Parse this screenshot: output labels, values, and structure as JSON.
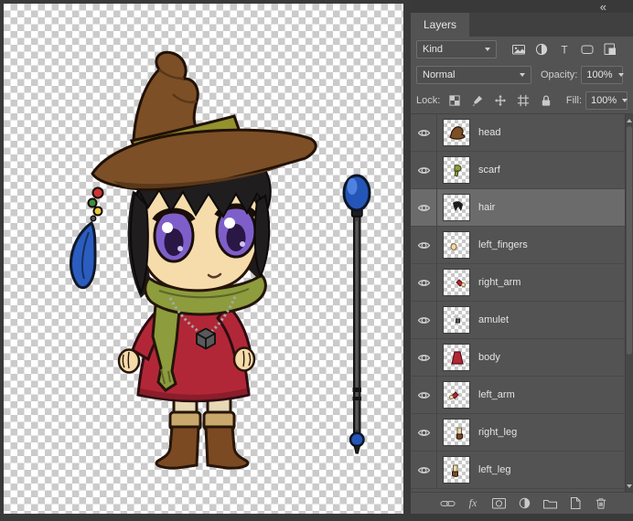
{
  "panel": {
    "collapse_glyph": "«",
    "tab_label": "Layers",
    "kind_label": "Kind",
    "blend_mode": "Normal",
    "opacity_label": "Opacity:",
    "opacity_value": "100%",
    "lock_label": "Lock:",
    "fill_label": "Fill:",
    "fill_value": "100%",
    "fx_label": "fx",
    "filter_icons": [
      "pixel-layers-filter-icon",
      "adjustment-layers-filter-icon",
      "type-layers-filter-icon",
      "shape-layers-filter-icon",
      "smart-objects-filter-icon"
    ],
    "lock_icons": [
      "lock-transparent-pixels-icon",
      "lock-image-pixels-icon",
      "lock-position-icon",
      "lock-artboard-icon",
      "lock-all-icon"
    ],
    "toolbar_icons": [
      "link-layers-icon",
      "layer-style-fx-icon",
      "add-layer-mask-icon",
      "new-adjustment-layer-icon",
      "new-group-icon",
      "new-layer-icon",
      "delete-layer-icon"
    ],
    "layers": [
      {
        "name": "head",
        "visible": true,
        "selected": false
      },
      {
        "name": "scarf",
        "visible": true,
        "selected": false
      },
      {
        "name": "hair",
        "visible": true,
        "selected": true
      },
      {
        "name": "left_fingers",
        "visible": true,
        "selected": false
      },
      {
        "name": "right_arm",
        "visible": true,
        "selected": false
      },
      {
        "name": "amulet",
        "visible": true,
        "selected": false
      },
      {
        "name": "body",
        "visible": true,
        "selected": false
      },
      {
        "name": "left_arm",
        "visible": true,
        "selected": false
      },
      {
        "name": "right_leg",
        "visible": true,
        "selected": false
      },
      {
        "name": "left_leg",
        "visible": true,
        "selected": false
      }
    ]
  },
  "canvas": {
    "content": "chibi witch character with brown hat, purple eyes, green scarf, red dress, boots, and a blue-orb staff on a transparency checkerboard",
    "palette": {
      "hat": "#7c4f26",
      "band": "#93922e",
      "hair": "#201d1e",
      "skin": "#f6dcab",
      "eyes": "#7e5fca",
      "scarf": "#8d9c3c",
      "dress": "#b22737",
      "boots": "#7b4a22",
      "staff_orb": "#2456b8",
      "checker": "#cbcbcb"
    }
  }
}
